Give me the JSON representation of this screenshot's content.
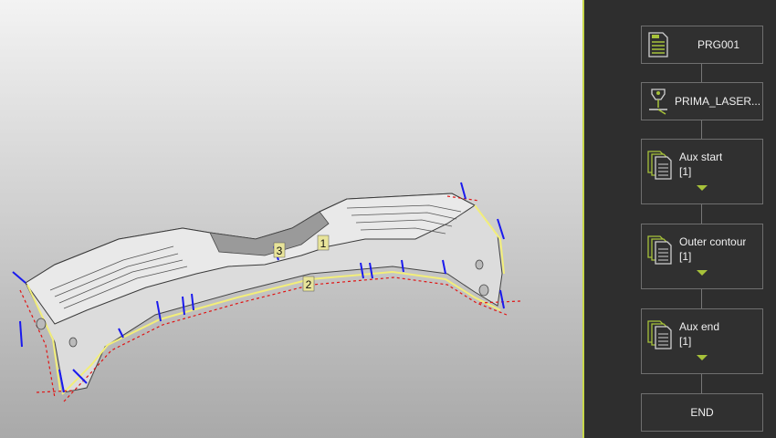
{
  "viewport": {
    "markers": [
      "1",
      "2",
      "3"
    ]
  },
  "flow": {
    "program": {
      "label": "PRG001",
      "icon": "program-file-icon"
    },
    "machine": {
      "label": "PRIMA_LASER...",
      "icon": "laser-head-icon"
    },
    "steps": [
      {
        "label": "Aux start",
        "count": "[1]",
        "icon": "multi-page-icon"
      },
      {
        "label": "Outer contour",
        "count": "[1]",
        "icon": "multi-page-icon"
      },
      {
        "label": "Aux end",
        "count": "[1]",
        "icon": "multi-page-icon"
      }
    ],
    "end": {
      "label": "END"
    }
  },
  "colors": {
    "accent": "#a7c23a",
    "panel": "#2e2e2e",
    "node_border": "#6f6f6f",
    "toolpath_blue": "#1a1aee",
    "toolpath_red": "#e01515",
    "contour_yellow": "#f2ee7a"
  }
}
